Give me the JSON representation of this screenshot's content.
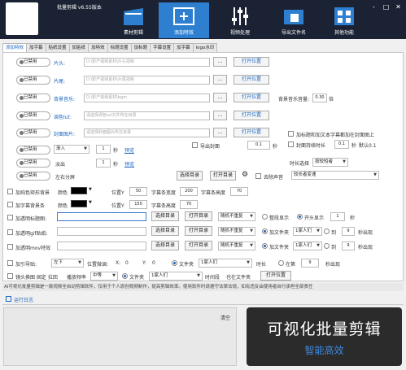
{
  "app": {
    "title": "批量剪辑 v6.55版本",
    "window_buttons": [
      "-",
      "□",
      "✕"
    ]
  },
  "nav": [
    {
      "label": "素材剪辑",
      "icon": "film-icon",
      "active": false
    },
    {
      "label": "添加特效",
      "icon": "add-effects-icon",
      "active": true
    },
    {
      "label": "视频处理",
      "icon": "sliders-icon",
      "active": false
    },
    {
      "label": "导出文件名",
      "icon": "folder-icon",
      "active": false
    },
    {
      "label": "其他功能",
      "icon": "grid-icon",
      "active": false
    }
  ],
  "tabs": [
    "添加特效",
    "加字幕",
    "贴纸设置",
    "加贴纸",
    "加特效",
    "标题设置",
    "加标题",
    "字幕设置",
    "加字幕",
    "logo水印"
  ],
  "toggle_label": "已禁用",
  "rows": {
    "head": {
      "label": "片头:",
      "placeholder": "D:\\影产视频素材\\片头视频",
      "browse": "...",
      "open": "打开位置"
    },
    "tail": {
      "label": "片尾:",
      "placeholder": "D:\\影产视频素材\\片尾视频",
      "browse": "...",
      "open": "打开位置"
    },
    "bgm": {
      "label": "背景音乐:",
      "placeholder": "D:\\影产视频素材\\bgm",
      "browse": "...",
      "open": "打开位置",
      "volume_label": "背景音乐音量:",
      "volume": "0.30",
      "volume_unit": "倍"
    },
    "filter": {
      "label": "调色lut:",
      "placeholder": "请选择调色lut文件所在目录",
      "browse": "...",
      "open": "打开位置"
    },
    "cover": {
      "label": "封面图片:",
      "placeholder": "请选择封面图片所在目录",
      "browse": "...",
      "open": "打开位置",
      "opt1": "加标题和加文本字幕都加在封面图上",
      "opt2": "封面持续时长",
      "opt2_value": "0.1",
      "opt2_unit": "秒",
      "opt2_default": "默认0.1"
    },
    "fadein": {
      "select": "渐入",
      "value": "1",
      "unit": "秒",
      "preview": "预览",
      "export_first": "导出封面",
      "export_value": "0.1",
      "export_unit": "秒"
    },
    "fadeout": {
      "select": "淡出",
      "value": "1",
      "unit": "秒",
      "preview": "预览",
      "duration_label": "时长选择",
      "duration_value": "按较短者"
    },
    "split": {
      "label": "左右分屏",
      "choose": "选择目录",
      "open": "打开目录",
      "mute": "去除声音",
      "mode": "较长者变速"
    }
  },
  "subtitles": {
    "bg": {
      "label": "加纯色矩形背景",
      "color_label": "颜色",
      "pos_label": "位置Y",
      "pos": "50",
      "width_label": "字幕条宽度",
      "width": "200",
      "height_label": "字幕条高度",
      "height": "70"
    },
    "bar": {
      "label": "加字幕背景条",
      "color_label": "颜色",
      "pos_label": "位置Y",
      "pos": "150",
      "height_label": "字幕条高度",
      "height": "70"
    }
  },
  "overlays": [
    {
      "label": "加透明标题图:",
      "choose": "选择目录",
      "open": "打开目录",
      "mode": "随机不重复",
      "r1": "整段显示",
      "r2": "开头显示",
      "r2_value": "1",
      "r2_unit": "秒"
    },
    {
      "label": "加透明gif贴纸:",
      "choose": "选择目录",
      "open": "打开目录",
      "mode": "随机不重复",
      "r1": "加文件夹",
      "sel": "1家人们",
      "r2": "到",
      "r2_value": "9",
      "r2_unit": "秒出现"
    },
    {
      "label": "加透明mov特效",
      "choose": "选择目录",
      "open": "打开目录",
      "mode": "随机不重复",
      "r1": "加文件夹",
      "sel": "1家人们",
      "r2": "到",
      "r2_value": "9",
      "r2_unit": "秒出现"
    }
  ],
  "trim": {
    "label": "加引导贴:",
    "pos": "左下",
    "pos_label": "位置微调:",
    "x_label": "X:",
    "x": "0",
    "y_label": "Y:",
    "y": "0",
    "r1": "文件夹",
    "sel": "1家人们",
    "time_label": "时长",
    "r2": "在第",
    "r2_value": "9",
    "r2_unit": "秒出现"
  },
  "mirror": {
    "label": "镜头换图 固定 拉回",
    "mode_label": "播放频率",
    "mode": "中等",
    "r1": "文件夹",
    "sel": "1家人们",
    "time_label": "时间段",
    "also_label": "也在文件夹",
    "open": "打开位置"
  },
  "footnote": "AI可视化批量剪辑是一款视频全自动剪辑软件，仅用于个人原创视频制作，提高剪辑效率。使用软件时请遵守法律法规，如有违反由使用者自行承担全部责任",
  "log": {
    "title": "运行日志",
    "clear": "清空"
  },
  "promo": {
    "title": "可视化批量剪辑",
    "subtitle": "智能高效"
  }
}
